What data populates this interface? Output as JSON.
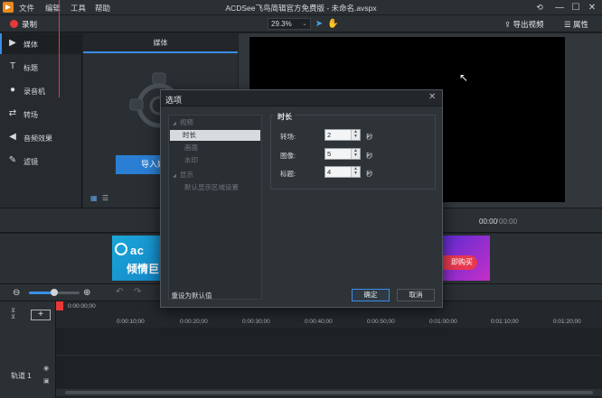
{
  "app": {
    "window_title": "ACDSee飞鸟简辑官方免费版 - 未命名.avspx",
    "menu": [
      "文件",
      "编辑",
      "工具",
      "帮助"
    ],
    "window_controls": {
      "minimize": "—",
      "maximize": "☐",
      "close": "✕"
    }
  },
  "toolbar": {
    "record_label": "录制",
    "zoom_value": "29.3%",
    "export_label": "导出视频",
    "properties_label": "属性"
  },
  "sidebar": {
    "items": [
      {
        "label": "媒体",
        "icon": "media-icon",
        "active": true
      },
      {
        "label": "标题",
        "icon": "title-icon",
        "active": false
      },
      {
        "label": "录音机",
        "icon": "microphone-icon",
        "active": false
      },
      {
        "label": "转场",
        "icon": "transition-icon",
        "active": false
      },
      {
        "label": "音频效果",
        "icon": "audio-effect-icon",
        "active": false
      },
      {
        "label": "滤镜",
        "icon": "filter-icon",
        "active": false
      }
    ]
  },
  "media_panel": {
    "tab_label": "媒体",
    "import_label": "导入媒体"
  },
  "playback": {
    "current_time": "00:00",
    "total_time": "00:00"
  },
  "banner": {
    "left_logo_text": "ac",
    "left_text": "倾情巨",
    "right_button": "即购买"
  },
  "timeline": {
    "ruler_start": "0:00:00;00",
    "ticks": [
      "0:00:10;00",
      "0:00:20;00",
      "0:00:30;00",
      "0:00:40;00",
      "0:00:50;00",
      "0:01:00;00",
      "0:01:10;00",
      "0:01:20;00"
    ],
    "track_label": "轨道 1"
  },
  "dialog": {
    "title": "选项",
    "tree": [
      {
        "label": "视频",
        "level": 0,
        "expandable": true,
        "selected": false
      },
      {
        "label": "时长",
        "level": 1,
        "selected": true
      },
      {
        "label": "画面",
        "level": 1,
        "selected": false
      },
      {
        "label": "水印",
        "level": 1,
        "selected": false
      },
      {
        "label": "显示",
        "level": 0,
        "expandable": true,
        "selected": false
      },
      {
        "label": "默认显示区域设置",
        "level": 1,
        "selected": false
      }
    ],
    "group_title": "时长",
    "fields": [
      {
        "label": "转场:",
        "value": "2",
        "unit": "秒"
      },
      {
        "label": "图像:",
        "value": "5",
        "unit": "秒"
      },
      {
        "label": "标题:",
        "value": "4",
        "unit": "秒"
      }
    ],
    "reset_label": "重设为默认值",
    "ok_label": "确定",
    "cancel_label": "取消"
  },
  "colors": {
    "accent": "#3a8ee6",
    "record": "#e8383a",
    "background": "#1f2327"
  }
}
